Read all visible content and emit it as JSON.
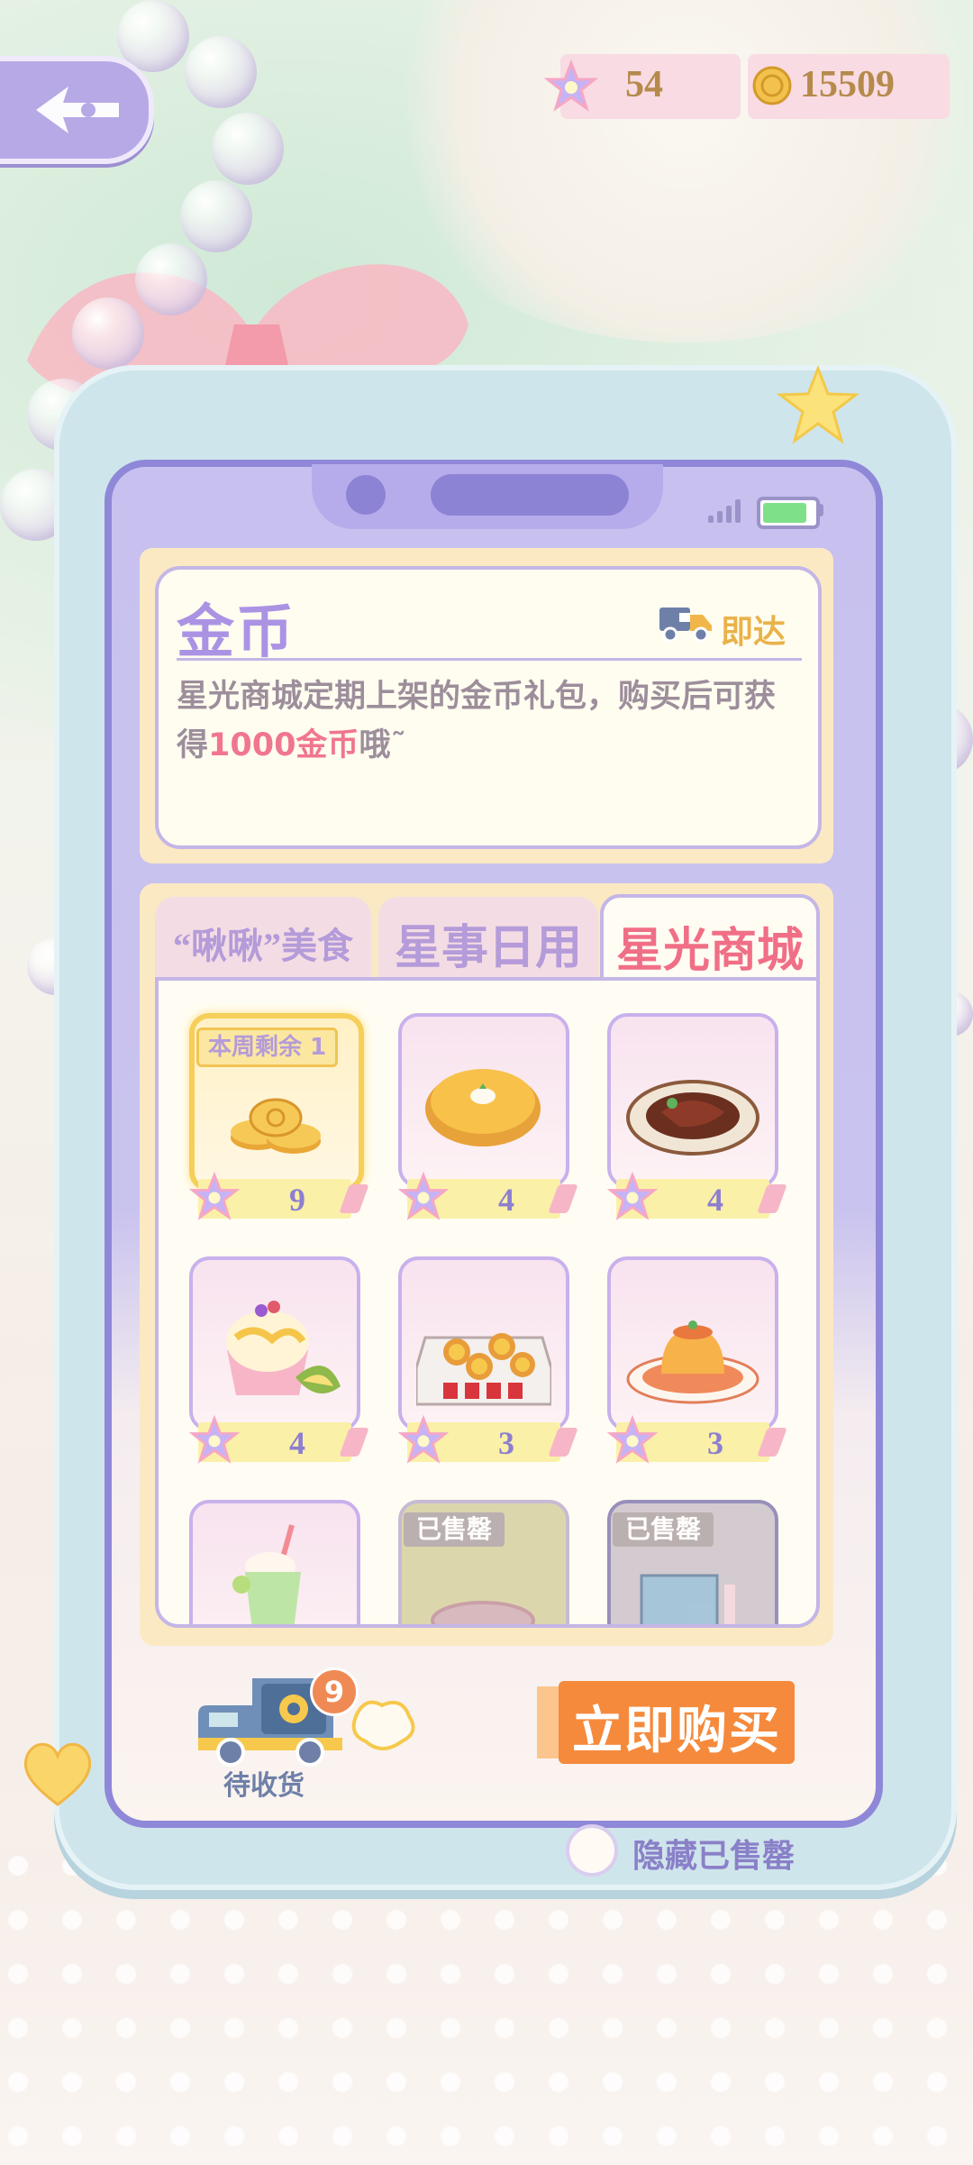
{
  "header": {
    "star_count": "54",
    "coin_count": "15509"
  },
  "info": {
    "title": "金币",
    "delivery_label": "即达",
    "desc_part1": "星光商城定期上架的金币礼包，购买后可获",
    "desc_part2": "得",
    "desc_highlight": "1000金币",
    "desc_part3": "哦˜"
  },
  "tabs": [
    {
      "label": "“啾啾”美食"
    },
    {
      "label": "星事日用"
    },
    {
      "label": "星光商城"
    }
  ],
  "items": [
    {
      "name": "gold-coins",
      "price": "9",
      "weekly_label": "本周剩余 1",
      "selected": true
    },
    {
      "name": "pie",
      "price": "4"
    },
    {
      "name": "steak",
      "price": "4"
    },
    {
      "name": "durian-shaved-ice",
      "price": "4"
    },
    {
      "name": "egg-tarts",
      "price": "3"
    },
    {
      "name": "pudding",
      "price": "3"
    },
    {
      "name": "matcha-drink",
      "price": ""
    },
    {
      "name": "sold-item-1",
      "sold_label": "已售罄"
    },
    {
      "name": "sold-item-2",
      "sold_label": "已售罄"
    }
  ],
  "bottom": {
    "pending_count": "9",
    "pending_label": "待收货",
    "buy_label": "立即购买",
    "hide_sold_label": "隐藏已售罄"
  },
  "colors": {
    "accent_purple": "#8f88d8",
    "price_text": "#8d7fd0",
    "buy_orange": "#f58a3c",
    "tab_active": "#f06f86"
  }
}
